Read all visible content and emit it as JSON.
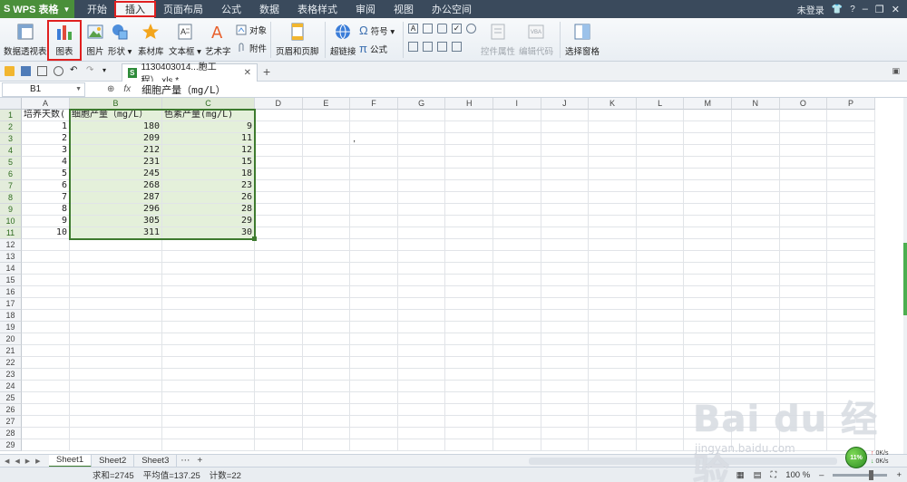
{
  "app": {
    "brand": "WPS 表格",
    "menu": [
      "开始",
      "插入",
      "页面布局",
      "公式",
      "数据",
      "表格样式",
      "审阅",
      "视图",
      "办公空间"
    ],
    "active_menu": "插入",
    "login": "未登录"
  },
  "ribbon": {
    "pivot": "数据透视表",
    "chart": "图表",
    "picture": "图片",
    "shape": "形状",
    "material": "素材库",
    "textbox": "文本框",
    "wordart": "艺术字",
    "object": "对象",
    "attachment": "附件",
    "header_footer": "页眉和页脚",
    "hyperlink": "超链接",
    "symbol": "符号",
    "formula": "公式",
    "control_props": "控件属性",
    "edit_code": "编辑代码",
    "selection_pane": "选择窗格"
  },
  "doc_tab": {
    "filename": "1130403014...胞工程）.xls *"
  },
  "formula_bar": {
    "name_box": "B1",
    "fx": "fx",
    "content": "细胞产量（mg/L）"
  },
  "columns": [
    "A",
    "B",
    "C",
    "D",
    "E",
    "F",
    "G",
    "H",
    "I",
    "J",
    "K",
    "L",
    "M",
    "N",
    "O",
    "P"
  ],
  "row_count": 29,
  "table": {
    "headers": [
      "培养天数(",
      "细胞产量（mg/L）",
      "色素产量(mg/L)"
    ],
    "rows": [
      [
        "1",
        "180",
        "9"
      ],
      [
        "2",
        "209",
        "11"
      ],
      [
        "3",
        "212",
        "12"
      ],
      [
        "4",
        "231",
        "15"
      ],
      [
        "5",
        "245",
        "18"
      ],
      [
        "6",
        "268",
        "23"
      ],
      [
        "7",
        "287",
        "26"
      ],
      [
        "8",
        "296",
        "28"
      ],
      [
        "9",
        "305",
        "29"
      ],
      [
        "10",
        "311",
        "30"
      ]
    ]
  },
  "stray_mark": ",",
  "sheets": [
    "Sheet1",
    "Sheet2",
    "Sheet3"
  ],
  "active_sheet": "Sheet1",
  "status": {
    "sum": "求和=2745",
    "avg": "平均值=137.25",
    "count": "计数=22",
    "zoom": "100 %"
  },
  "network": {
    "badge": "11%",
    "up": "0K/s",
    "down": "0K/s"
  },
  "watermark": {
    "main": "Bai du 经验",
    "sub": "jingyan.baidu.com"
  },
  "colors": {
    "selection": "#3d7a2e",
    "selection_fill": "#e4f0da",
    "highlight_box": "#e02020",
    "menubar": "#3a4a5c"
  }
}
